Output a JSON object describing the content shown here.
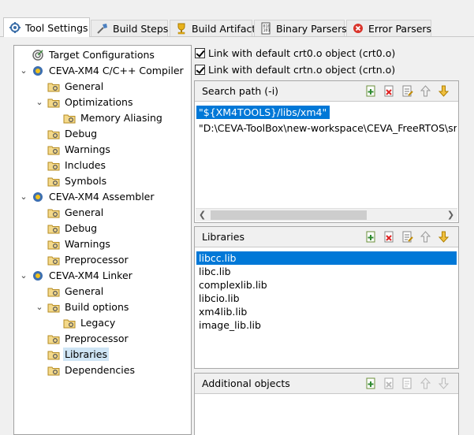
{
  "tabs": [
    {
      "label": "Tool Settings",
      "icon": "tool-settings-icon",
      "active": true
    },
    {
      "label": "Build Steps",
      "icon": "build-steps-icon",
      "active": false
    },
    {
      "label": "Build Artifact",
      "icon": "trophy-icon",
      "active": false
    },
    {
      "label": "Binary Parsers",
      "icon": "binary-parser-icon",
      "active": false
    },
    {
      "label": "Error Parsers",
      "icon": "error-icon",
      "active": false
    }
  ],
  "tree": [
    {
      "label": "Target Configurations",
      "icon": "target-icon",
      "level": 1
    },
    {
      "label": "CEVA-XM4 C/C++ Compiler",
      "icon": "ceva-tool-icon",
      "level": 1,
      "expanded": true
    },
    {
      "label": "General",
      "icon": "settings-folder-icon",
      "level": 2
    },
    {
      "label": "Optimizations",
      "icon": "settings-folder-icon",
      "level": 2,
      "expanded": true
    },
    {
      "label": "Memory Aliasing",
      "icon": "settings-folder-icon",
      "level": 3
    },
    {
      "label": "Debug",
      "icon": "settings-folder-icon",
      "level": 2
    },
    {
      "label": "Warnings",
      "icon": "settings-folder-icon",
      "level": 2
    },
    {
      "label": "Includes",
      "icon": "settings-folder-icon",
      "level": 2
    },
    {
      "label": "Symbols",
      "icon": "settings-folder-icon",
      "level": 2
    },
    {
      "label": "CEVA-XM4 Assembler",
      "icon": "ceva-tool-icon",
      "level": 1,
      "expanded": true
    },
    {
      "label": "General",
      "icon": "settings-folder-icon",
      "level": 2
    },
    {
      "label": "Debug",
      "icon": "settings-folder-icon",
      "level": 2
    },
    {
      "label": "Warnings",
      "icon": "settings-folder-icon",
      "level": 2
    },
    {
      "label": "Preprocessor",
      "icon": "settings-folder-icon",
      "level": 2
    },
    {
      "label": "CEVA-XM4 Linker",
      "icon": "ceva-tool-icon",
      "level": 1,
      "expanded": true
    },
    {
      "label": "General",
      "icon": "settings-folder-icon",
      "level": 2
    },
    {
      "label": "Build options",
      "icon": "settings-folder-icon",
      "level": 2,
      "expanded": true
    },
    {
      "label": "Legacy",
      "icon": "settings-folder-icon",
      "level": 3
    },
    {
      "label": "Preprocessor",
      "icon": "settings-folder-icon",
      "level": 2
    },
    {
      "label": "Libraries",
      "icon": "settings-folder-icon",
      "level": 2,
      "selected": true
    },
    {
      "label": "Dependencies",
      "icon": "settings-folder-icon",
      "level": 2
    }
  ],
  "options": {
    "crt0": {
      "label": "Link with default crt0.o object (crt0.o)",
      "checked": true
    },
    "crtn": {
      "label": "Link with default crtn.o object (crtn.o)",
      "checked": true
    }
  },
  "search_path": {
    "title": "Search path (-i)",
    "items": [
      "\"${XM4TOOLS}/libs/xm4\"",
      "\"D:\\CEVA-ToolBox\\new-workspace\\CEVA_FreeRTOS\\src\\l"
    ]
  },
  "libraries": {
    "title": "Libraries",
    "items": [
      "libcc.lib",
      "libc.lib",
      "complexlib.lib",
      "libcio.lib",
      "xm4lib.lib",
      "image_lib.lib"
    ]
  },
  "additional_objects": {
    "title": "Additional objects",
    "items": []
  },
  "toolbar": [
    "add-icon",
    "delete-icon",
    "edit-icon",
    "move-up-icon",
    "move-down-icon"
  ],
  "colors": {
    "selection": "#0078d7",
    "tree_selection": "#cfe5f5"
  }
}
